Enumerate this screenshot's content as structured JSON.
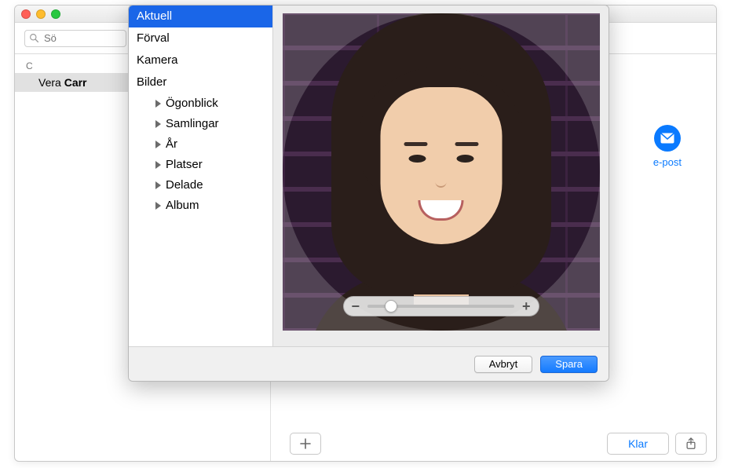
{
  "search": {
    "placeholder": "Sö"
  },
  "contacts": {
    "section": "C",
    "selected": {
      "first": "Vera",
      "last": "Carr"
    }
  },
  "detail": {
    "epost_label": "e-post"
  },
  "bottom": {
    "klar_label": "Klar"
  },
  "popover": {
    "sidebar": {
      "items": [
        "Aktuell",
        "Förval",
        "Kamera",
        "Bilder"
      ],
      "subitems": [
        "Ögonblick",
        "Samlingar",
        "År",
        "Platser",
        "Delade",
        "Album"
      ]
    },
    "footer": {
      "cancel": "Avbryt",
      "save": "Spara"
    }
  }
}
